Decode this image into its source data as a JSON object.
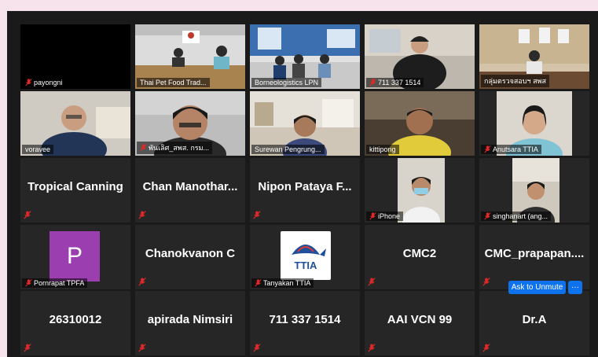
{
  "meeting": {
    "tiles": [
      {
        "name": "payongni"
      },
      {
        "name": "Thai Pet Food Trad..."
      },
      {
        "name": "Borneologistics LPN"
      },
      {
        "name": "711 337 1514"
      },
      {
        "name": "กลุ่มตรวจสอบฯ สพส"
      },
      {
        "name": "voravee"
      },
      {
        "name": "พันเลิศ_สพส. กรม..."
      },
      {
        "name": "Surewan Pengrung..."
      },
      {
        "name": "kittipong"
      },
      {
        "name": "Anutsara TTIA"
      },
      {
        "name": "Tropical Canning"
      },
      {
        "name": "Chan  Manothar..."
      },
      {
        "name": "Nipon Pataya F..."
      },
      {
        "name": "iPhone"
      },
      {
        "name": "singhanart (ang..."
      },
      {
        "name": "Pornrapat TPFA",
        "avatar_letter": "P",
        "avatar_color": "#9b3fb0"
      },
      {
        "name": "Chanokvanon C"
      },
      {
        "name": "Tanyakan TTIA",
        "logo_text": "TTIA"
      },
      {
        "name": "CMC2"
      },
      {
        "name": "CMC_prapapan...."
      },
      {
        "name": "26310012"
      },
      {
        "name": "apirada Nimsiri"
      },
      {
        "name": "711 337 1514"
      },
      {
        "name": "AAI VCN 99"
      },
      {
        "name": "Dr.A"
      }
    ],
    "ask_unmute_label": "Ask to Unmute",
    "more_label": "···",
    "active_speaker_color": "#b7e34d",
    "muted_icon": "mic-muted-icon",
    "muted_color": "#e02828"
  }
}
